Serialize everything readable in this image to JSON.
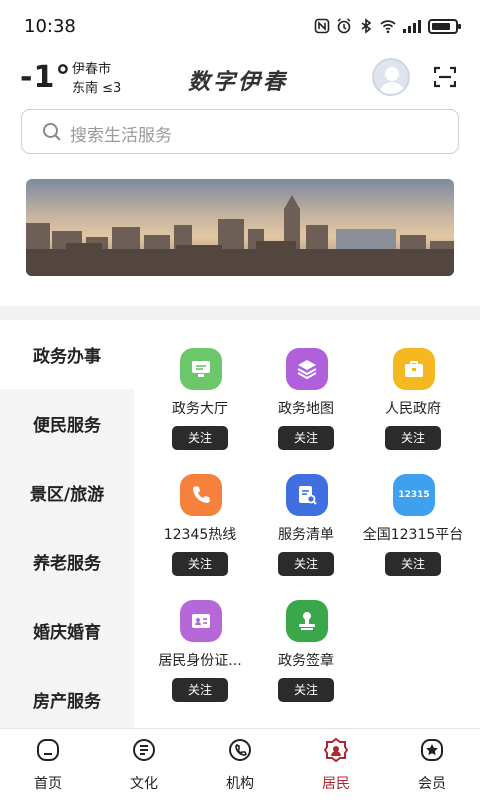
{
  "status_bar": {
    "time": "10:38",
    "icons": [
      "nfc-icon",
      "alarm-icon",
      "bluetooth-icon",
      "wifi-icon",
      "signal-icon",
      "battery-icon"
    ]
  },
  "header": {
    "temperature": "-1°",
    "city": "伊春市",
    "wind": "东南 ≤3",
    "brand": "数字伊春"
  },
  "search": {
    "placeholder": "搜索生活服务"
  },
  "categories": [
    {
      "label": "政务办事",
      "active": true
    },
    {
      "label": "便民服务",
      "active": false
    },
    {
      "label": "景区/旅游",
      "active": false
    },
    {
      "label": "养老服务",
      "active": false
    },
    {
      "label": "婚庆婚育",
      "active": false
    },
    {
      "label": "房产服务",
      "active": false
    }
  ],
  "services": [
    {
      "label": "政务大厅",
      "icon": "monitor-icon",
      "color": "#6cc66a",
      "follow": "关注"
    },
    {
      "label": "政务地图",
      "icon": "layers-icon",
      "color": "#b060db",
      "follow": "关注"
    },
    {
      "label": "人民政府",
      "icon": "briefcase-icon",
      "color": "#f6b820",
      "follow": "关注"
    },
    {
      "label": "12345热线",
      "icon": "phone-icon",
      "color": "#f5813d",
      "follow": "关注"
    },
    {
      "label": "服务清单",
      "icon": "document-search-icon",
      "color": "#3f6fe0",
      "follow": "关注"
    },
    {
      "label": "全国12315平台",
      "icon": "badge-12315-icon",
      "icon_text": "12315",
      "color": "#3fa0ef",
      "follow": "关注"
    },
    {
      "label": "居民身份证...",
      "icon": "id-card-icon",
      "color": "#b569d9",
      "follow": "关注"
    },
    {
      "label": "政务签章",
      "icon": "stamp-icon",
      "color": "#3aa84a",
      "follow": "关注"
    }
  ],
  "tabs": [
    {
      "label": "首页",
      "icon": "home-icon",
      "active": false
    },
    {
      "label": "文化",
      "icon": "culture-icon",
      "active": false
    },
    {
      "label": "机构",
      "icon": "institution-icon",
      "active": false
    },
    {
      "label": "居民",
      "icon": "resident-icon",
      "active": true
    },
    {
      "label": "会员",
      "icon": "member-icon",
      "active": false
    }
  ],
  "colors": {
    "accent": "#b3262f",
    "follow_button": "#2b2b2b"
  }
}
